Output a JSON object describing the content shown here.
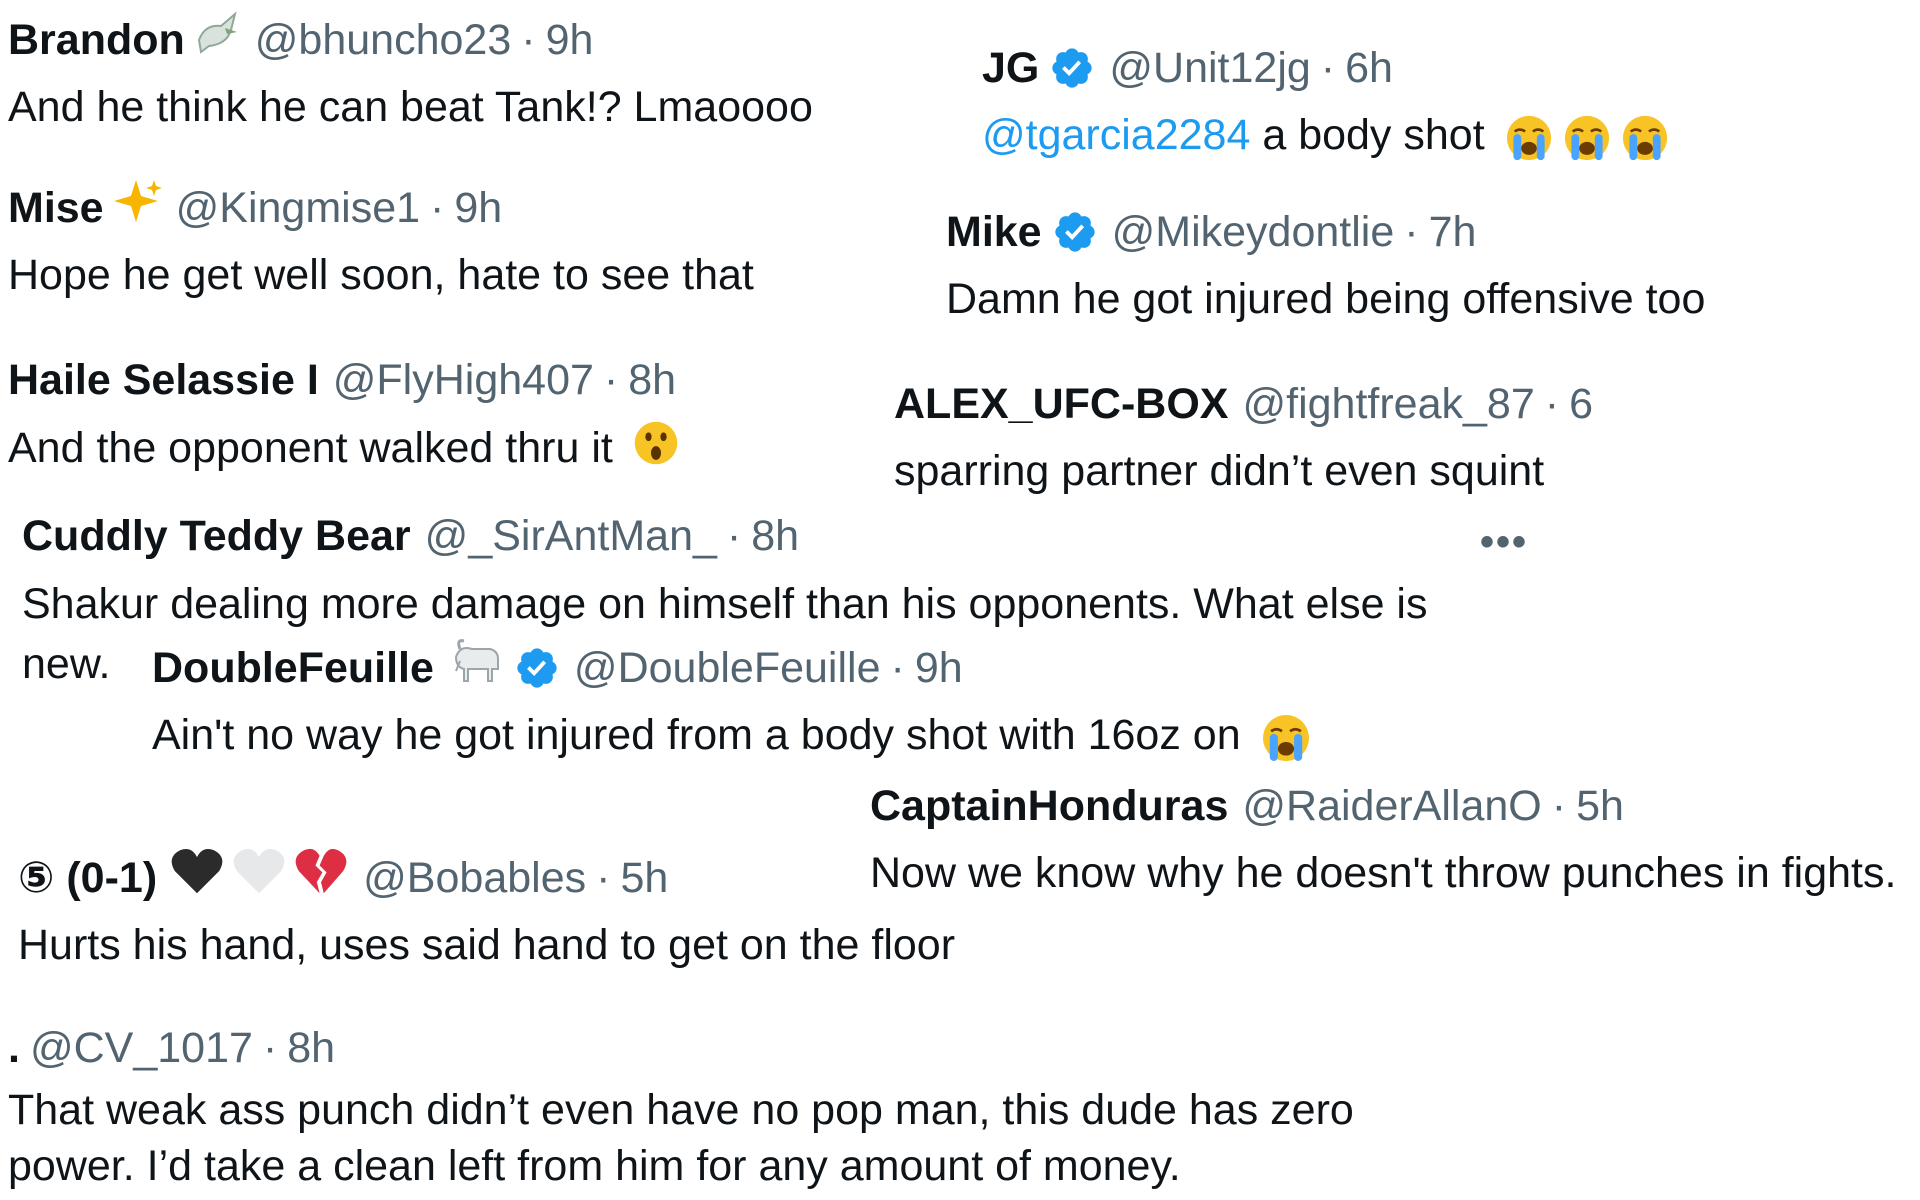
{
  "tweets": [
    {
      "name": "Brandon",
      "name_emoji": "dove",
      "handle": "@bhuncho23",
      "sep": "·",
      "time": "9h",
      "text": "And he think he can beat Tank!? Lmaoooo"
    },
    {
      "name": "JG",
      "verified": true,
      "handle": "@Unit12jg",
      "sep": "·",
      "time": "6h",
      "mention": "@tgarcia2284",
      "text": "a body shot"
    },
    {
      "name": "Mise",
      "name_emoji": "sparkles",
      "handle": "@Kingmise1",
      "sep": "·",
      "time": "9h",
      "text": "Hope he get well soon, hate to see that"
    },
    {
      "name": "Mike",
      "verified": true,
      "handle": "@Mikeydontlie",
      "sep": "·",
      "time": "7h",
      "text": "Damn he got injured being offensive too"
    },
    {
      "name": "Haile Selassie I",
      "handle": "@FlyHigh407",
      "sep": "·",
      "time": "8h",
      "text": "And the opponent walked thru it"
    },
    {
      "name": "ALEX_UFC-BOX",
      "handle": "@fightfreak_87",
      "sep": "·",
      "time": "6",
      "text": "sparring partner didn’t even squint"
    },
    {
      "name": "Cuddly Teddy Bear",
      "handle": "@_SirAntMan_",
      "sep": "·",
      "time": "8h",
      "text": "Shakur dealing more damage on himself than his opponents. What else is new.",
      "more": "•••"
    },
    {
      "name": "DoubleFeuille",
      "name_emoji": "goat",
      "verified": true,
      "handle": "@DoubleFeuille",
      "sep": "·",
      "time": "9h",
      "text": "Ain't no way he got injured from a body shot with 16oz on"
    },
    {
      "name": "CaptainHonduras",
      "handle": "@RaiderAllanO",
      "sep": "·",
      "time": "5h",
      "text": "Now we know why he doesn't throw punches in fights."
    },
    {
      "name": "⑤ (0-1)",
      "name_emoji": "black-heart white-heart broken-heart",
      "handle": "@Bobables",
      "sep": "·",
      "time": "5h",
      "text": "Hurts his hand, uses said hand to get on the floor"
    },
    {
      "name": ".",
      "handle": "@CV_1017",
      "sep": "·",
      "time": "8h",
      "text": "That weak ass punch didn’t even have no pop man, this dude has zero power. I’d take a clean left from him for any amount of money."
    }
  ],
  "colors": {
    "name": "#0f1419",
    "muted": "#536471",
    "link": "#1d9bf0",
    "verified": "#1d9bf0",
    "crying-emoji": "#f7c325"
  },
  "icons": [
    "verified-badge-icon",
    "dove-emoji-icon",
    "sparkles-emoji-icon",
    "goat-emoji-icon",
    "astonished-face-emoji-icon",
    "crying-face-emoji-icon",
    "black-heart-emoji-icon",
    "white-heart-emoji-icon",
    "broken-heart-emoji-icon"
  ]
}
